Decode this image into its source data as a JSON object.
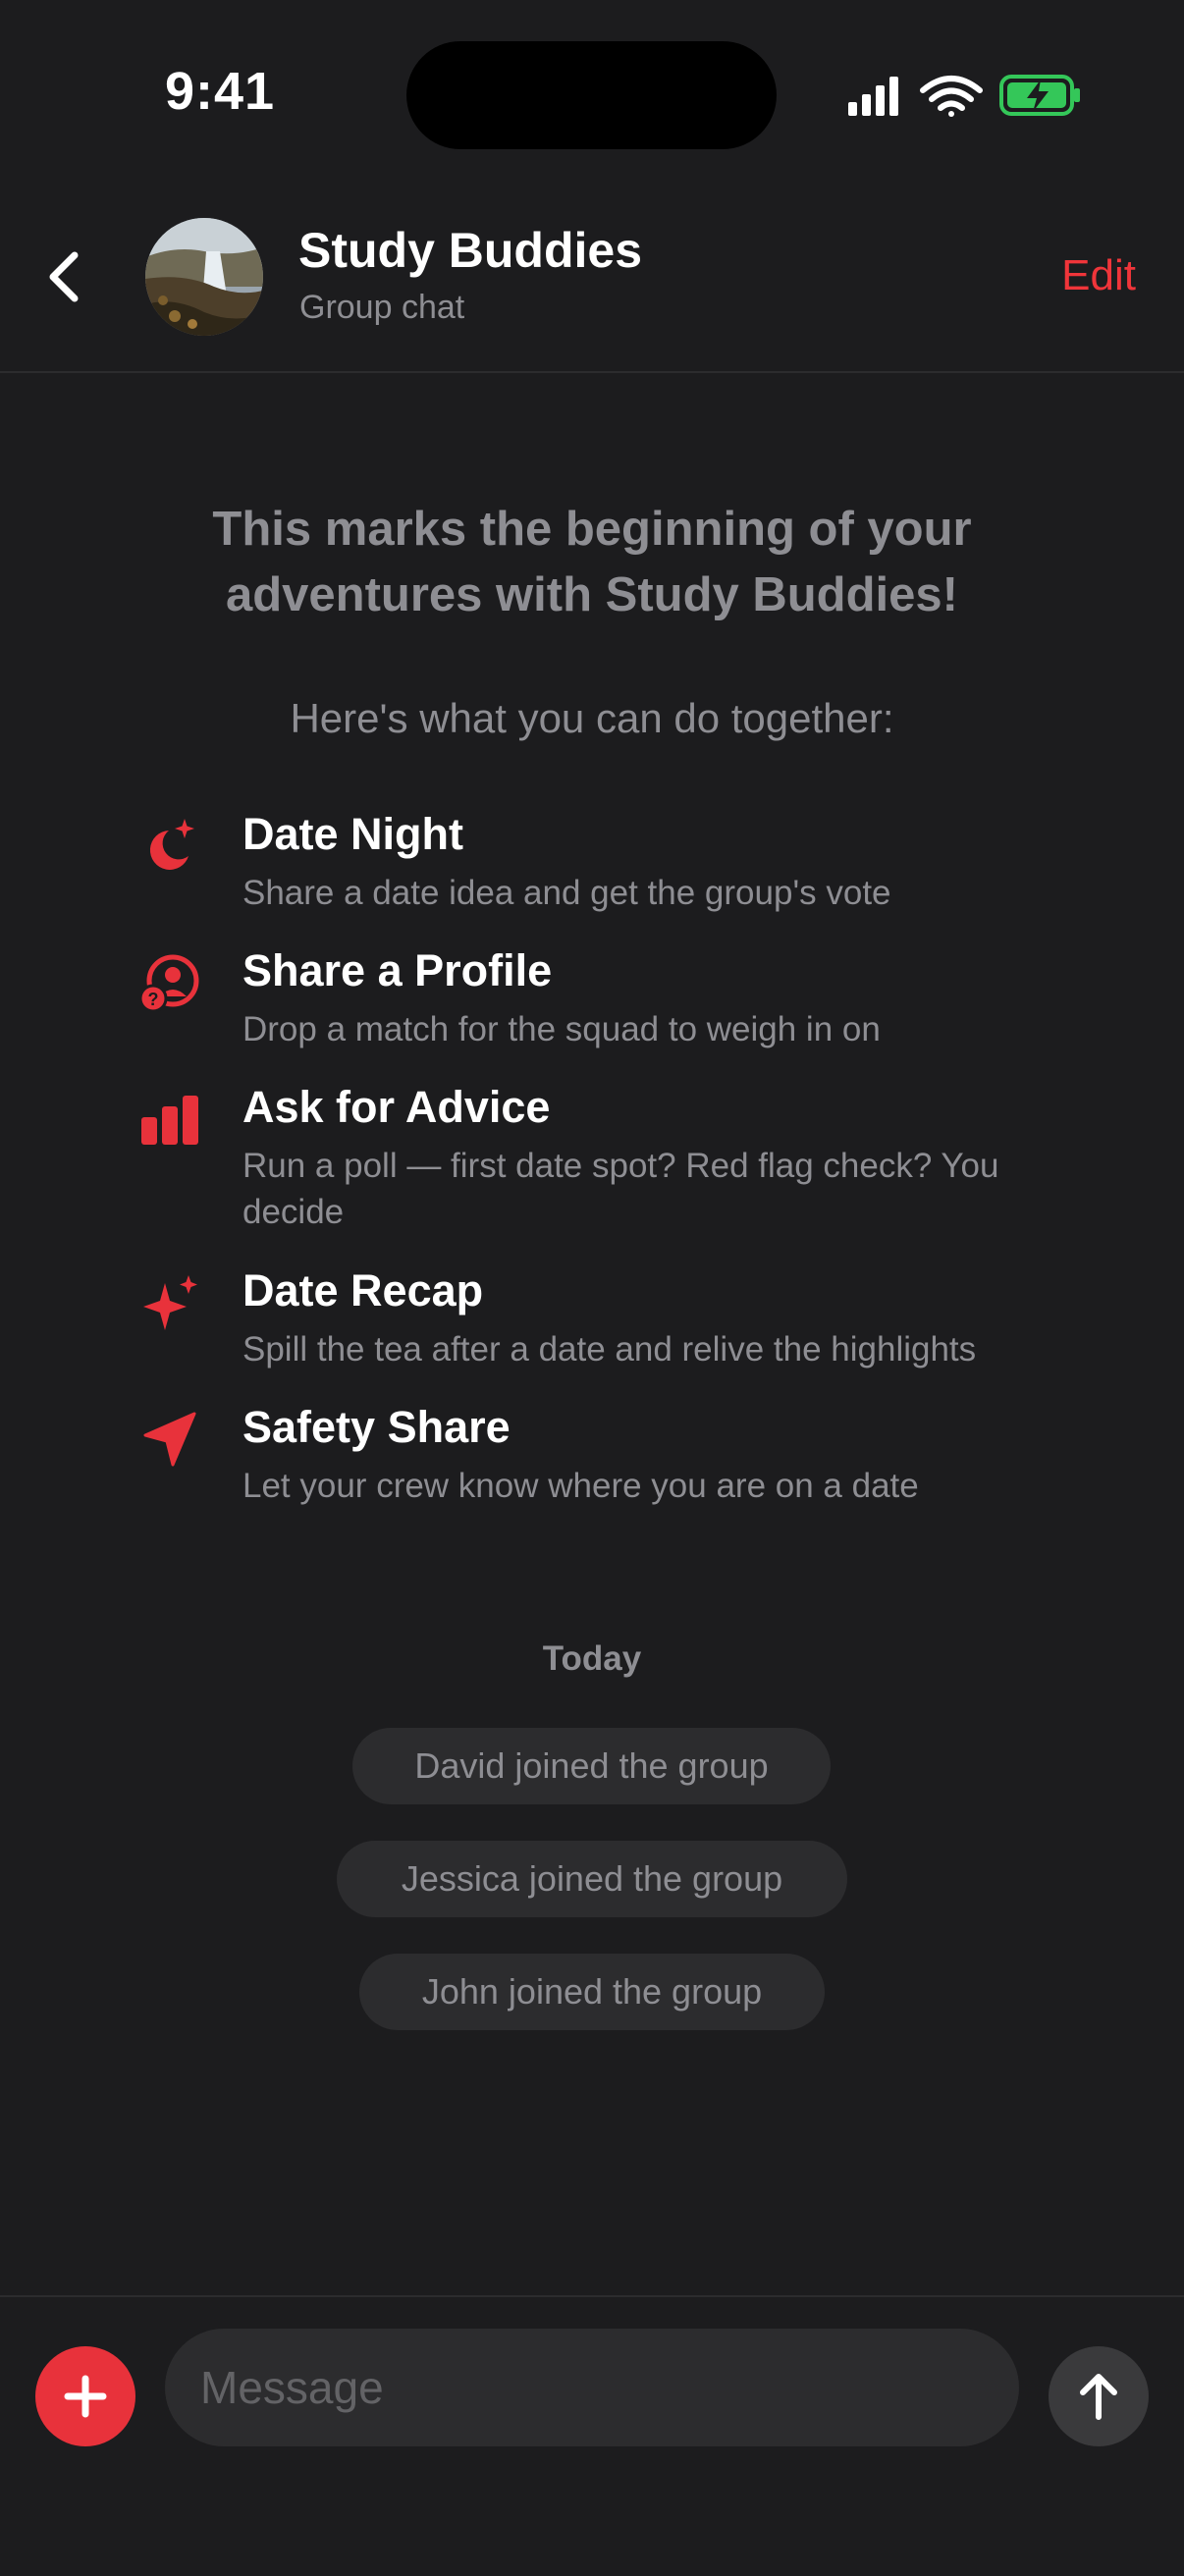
{
  "status_bar": {
    "time": "9:41",
    "icons": [
      "cellular-signal-icon",
      "wifi-icon",
      "battery-charging-icon"
    ]
  },
  "header": {
    "title": "Study Buddies",
    "subtitle": "Group chat",
    "edit_label": "Edit",
    "back_icon": "chevron-left-icon"
  },
  "intro": {
    "title": "This marks the beginning of your adventures with Study Buddies!",
    "subtitle": "Here's what you can do together:"
  },
  "features": [
    {
      "icon": "moon-sparkle-icon",
      "title": "Date Night",
      "desc": "Share a date idea and get the group's vote"
    },
    {
      "icon": "profile-question-icon",
      "title": "Share a Profile",
      "desc": "Drop a match for the squad to weigh in on"
    },
    {
      "icon": "bar-chart-icon",
      "title": "Ask for Advice",
      "desc": "Run a poll — first date spot? Red flag check? You decide"
    },
    {
      "icon": "sparkles-icon",
      "title": "Date Recap",
      "desc": "Spill the tea after a date and relive the highlights"
    },
    {
      "icon": "location-arrow-icon",
      "title": "Safety Share",
      "desc": "Let your crew know where you are on a date"
    }
  ],
  "timeline": {
    "day_label": "Today",
    "events": [
      "David joined the group",
      "Jessica joined the group",
      "John joined the group"
    ]
  },
  "composer": {
    "placeholder": "Message",
    "add_icon": "plus-icon",
    "send_icon": "arrow-up-icon"
  },
  "colors": {
    "background": "#1c1c1e",
    "accent": "#e8323b",
    "secondary_text": "#8e8e93",
    "pill_background": "#2c2c2e",
    "battery_green": "#34c759"
  }
}
